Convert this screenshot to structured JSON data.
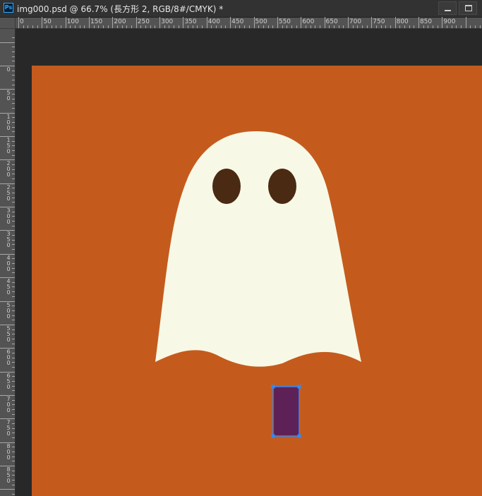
{
  "window": {
    "title": "img000.psd @ 66.7% (長方形 2, RGB/8#/CMYK) *",
    "app_icon_text": "Ps"
  },
  "rulers": {
    "top_labels": [
      "0",
      "50",
      "100",
      "150",
      "200",
      "250",
      "300",
      "350",
      "400",
      "450",
      "500",
      "550",
      "600",
      "650",
      "700",
      "750",
      "800",
      "850",
      "900"
    ],
    "left_labels": [
      "0",
      "50",
      "100",
      "150",
      "200",
      "250",
      "300",
      "350",
      "400",
      "450",
      "500",
      "550",
      "600",
      "650",
      "700",
      "750",
      "800",
      "850",
      "900"
    ]
  },
  "colors": {
    "canvas_background": "#c45b1d",
    "ghost_body": "#f8f8e6",
    "ghost_eyes": "#4a2a12",
    "selected_rectangle": "#5e2157",
    "selection_handles": "#2d8bff"
  },
  "layers": {
    "selected_layer": "長方形 2"
  }
}
